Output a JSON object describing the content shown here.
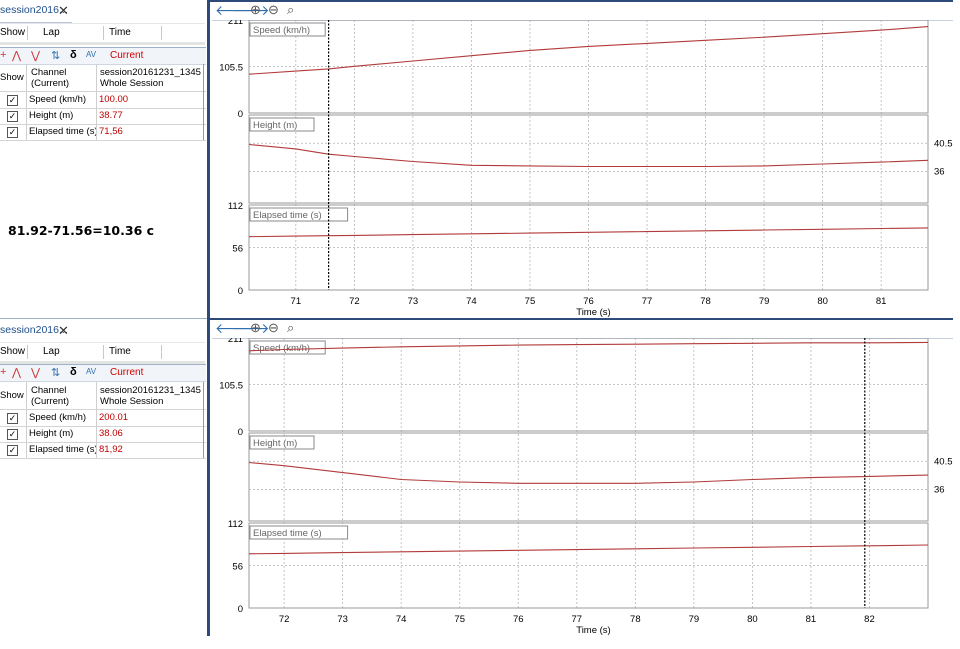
{
  "top": {
    "tab_title": "session2016...",
    "lap_headers": [
      "Show",
      "Lap",
      "Time"
    ],
    "current_label": "Current",
    "delta_label": "δ",
    "av_label": "AV",
    "table_header": {
      "show": "Show",
      "channel": "Channel",
      "current": "(Current)",
      "session": "session20161231_1345",
      "scope": "Whole Session"
    },
    "rows": [
      {
        "name": "Speed (km/h)",
        "value": "100.00"
      },
      {
        "name": "Height (m)",
        "value": "38.77"
      },
      {
        "name": "Elapsed time (s)",
        "value": "71,56"
      }
    ],
    "plot": {
      "xticks": [
        "71",
        "72",
        "73",
        "74",
        "75",
        "76",
        "77",
        "78",
        "79",
        "80",
        "81"
      ],
      "x_range": [
        70.2,
        81.8
      ],
      "cursor_x": 71.56,
      "xlabel": "Time (s)"
    }
  },
  "bottom": {
    "tab_title": "session2016...",
    "lap_headers": [
      "Show",
      "Lap",
      "Time"
    ],
    "current_label": "Current",
    "delta_label": "δ",
    "av_label": "AV",
    "table_header": {
      "show": "Show",
      "channel": "Channel",
      "current": "(Current)",
      "session": "session20161231_1345",
      "scope": "Whole Session"
    },
    "rows": [
      {
        "name": "Speed (km/h)",
        "value": "200.01"
      },
      {
        "name": "Height (m)",
        "value": "38.06"
      },
      {
        "name": "Elapsed time (s)",
        "value": "81,92"
      }
    ],
    "plot": {
      "xticks": [
        "72",
        "73",
        "74",
        "75",
        "76",
        "77",
        "78",
        "79",
        "80",
        "81",
        "82"
      ],
      "x_range": [
        71.4,
        83.0
      ],
      "cursor_x": 81.92,
      "xlabel": "Time (s)"
    }
  },
  "note": "81.92-71.56=10.36 с",
  "channels": {
    "speed": {
      "label": "Speed (km/h)",
      "yticks": [
        "211",
        "105.5",
        "0"
      ],
      "range": [
        0,
        211
      ]
    },
    "height": {
      "label": "Height (m)",
      "yticks_right": [
        "40.5",
        "36"
      ],
      "range": [
        31,
        45
      ]
    },
    "elapsed": {
      "label": "Elapsed time (s)",
      "yticks": [
        "112",
        "56",
        "0"
      ],
      "range": [
        0,
        112
      ]
    }
  },
  "chart_data": [
    {
      "type": "line",
      "title": "",
      "xlabel": "Time (s)",
      "xlim": [
        70.2,
        81.8
      ],
      "series": [
        {
          "name": "Speed (km/h)",
          "ylim": [
            0,
            211
          ],
          "x": [
            70.2,
            71,
            71.56,
            72,
            73,
            74,
            75,
            76,
            77,
            78,
            79,
            80,
            81,
            81.8
          ],
          "y": [
            88,
            95,
            100,
            106,
            118,
            130,
            142,
            151,
            158,
            165,
            172,
            180,
            188,
            196
          ]
        },
        {
          "name": "Height (m)",
          "ylim": [
            31,
            45
          ],
          "x": [
            70.2,
            71,
            71.56,
            72,
            73,
            74,
            75,
            76,
            77,
            78,
            79,
            80,
            81,
            81.8
          ],
          "y": [
            40.3,
            39.6,
            38.77,
            38.4,
            37.6,
            37.0,
            36.9,
            36.8,
            36.8,
            36.8,
            36.9,
            37.2,
            37.5,
            37.8
          ]
        },
        {
          "name": "Elapsed time (s)",
          "ylim": [
            0,
            112
          ],
          "x": [
            70.2,
            71,
            71.56,
            72,
            73,
            74,
            75,
            76,
            77,
            78,
            79,
            80,
            81,
            81.8
          ],
          "y": [
            70.2,
            71,
            71.56,
            72,
            73,
            74,
            75,
            76,
            77,
            78,
            79,
            80,
            81,
            81.8
          ]
        }
      ]
    },
    {
      "type": "line",
      "title": "",
      "xlabel": "Time (s)",
      "xlim": [
        71.4,
        83.0
      ],
      "series": [
        {
          "name": "Speed (km/h)",
          "ylim": [
            0,
            211
          ],
          "x": [
            71.4,
            72,
            73,
            74,
            75,
            76,
            77,
            78,
            79,
            80,
            81,
            81.92,
            82,
            83.0
          ],
          "y": [
            182,
            185,
            188,
            191,
            193,
            195,
            196,
            197,
            198,
            199,
            200,
            200.01,
            200.2,
            201
          ]
        },
        {
          "name": "Height (m)",
          "ylim": [
            31,
            45
          ],
          "x": [
            71.4,
            72,
            73,
            74,
            75,
            76,
            77,
            78,
            79,
            80,
            81,
            81.92,
            82,
            83.0
          ],
          "y": [
            40.3,
            39.8,
            38.7,
            37.6,
            37.2,
            37.0,
            37.0,
            37.0,
            37.2,
            37.6,
            37.9,
            38.06,
            38.1,
            38.3
          ]
        },
        {
          "name": "Elapsed time (s)",
          "ylim": [
            0,
            112
          ],
          "x": [
            71.4,
            72,
            73,
            74,
            75,
            76,
            77,
            78,
            79,
            80,
            81,
            81.92,
            82,
            83.0
          ],
          "y": [
            71.4,
            72,
            73,
            74,
            75,
            76,
            77,
            78,
            79,
            80,
            81,
            81.92,
            82,
            83.0
          ]
        }
      ]
    }
  ]
}
